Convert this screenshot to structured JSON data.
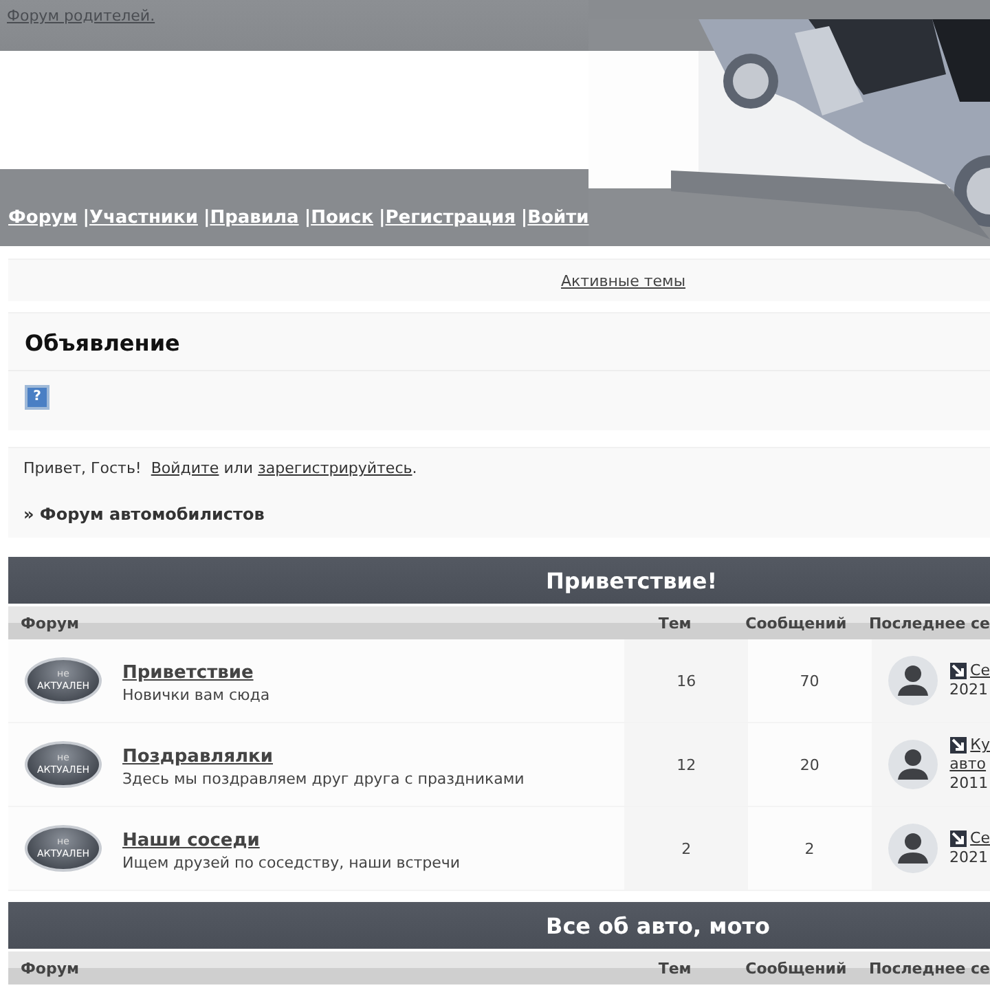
{
  "top_link": "Форум родителей.",
  "nav": {
    "separator": "|",
    "items": [
      "Форум",
      "Участники",
      "Правила",
      "Поиск",
      "Регистрация",
      "Войти"
    ]
  },
  "active_topics_link": "Активные темы",
  "announcement": {
    "title": "Объявление",
    "icon": "?"
  },
  "welcome": {
    "greeting": "Привет, Гость!",
    "login": "Войдите",
    "or": "или",
    "register": "зарегистрируйтесь",
    "end": "."
  },
  "breadcrumb": "» Форум автомобилистов",
  "categories": [
    {
      "title": "Приветствие!",
      "columns": [
        "Форум",
        "Тем",
        "Сообщений",
        "Последнее се"
      ],
      "forums": [
        {
          "badge_top": "не",
          "badge": "АКТУАЛЕН",
          "name": "Приветствие",
          "description": "Новички вам сюда",
          "topics": "16",
          "posts": "70",
          "last_post": {
            "title_lines": [
              "Се"
            ],
            "date": "2021"
          }
        },
        {
          "badge_top": "не",
          "badge": "АКТУАЛЕН",
          "name": "Поздравлялки",
          "description": "Здесь мы поздравляем друг друга с праздниками",
          "topics": "12",
          "posts": "20",
          "last_post": {
            "title_lines": [
              "Ку",
              "авто"
            ],
            "date": "2011"
          }
        },
        {
          "badge_top": "не",
          "badge": "АКТУАЛЕН",
          "name": "Наши соседи",
          "description": "Ищем друзей по соседству, наши встречи",
          "topics": "2",
          "posts": "2",
          "last_post": {
            "title_lines": [
              "Се"
            ],
            "date": "2021"
          }
        }
      ]
    },
    {
      "title": "Все об авто, мото",
      "columns": [
        "Форум",
        "Тем",
        "Сообщений",
        "Последнее се"
      ]
    }
  ]
}
